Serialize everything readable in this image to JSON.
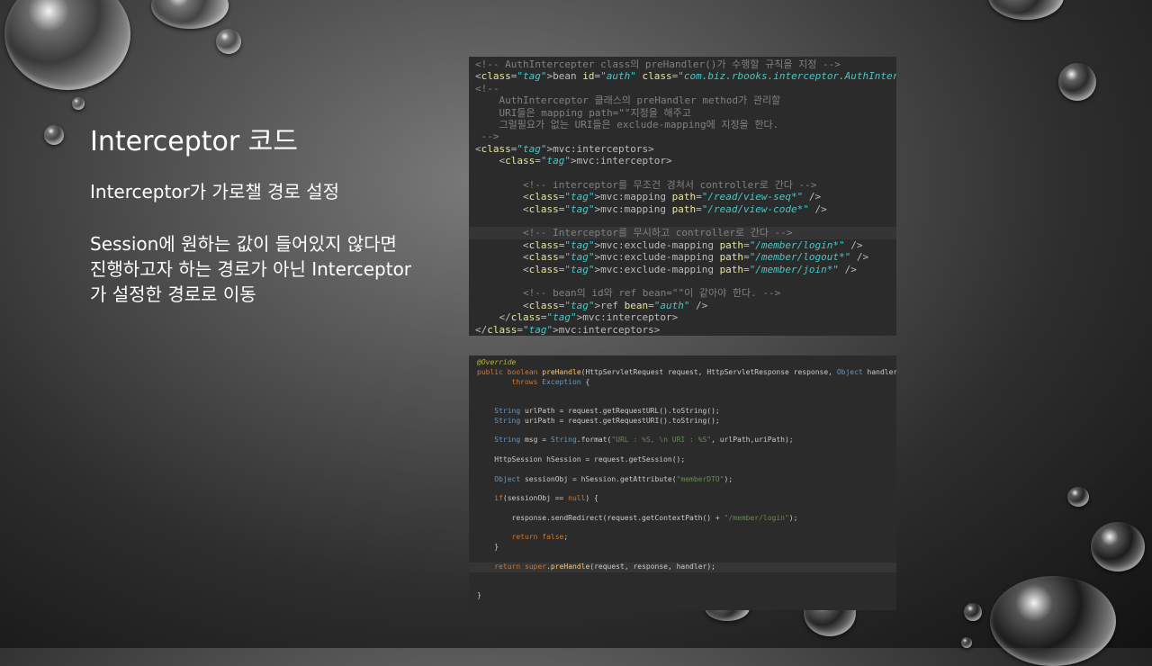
{
  "slide": {
    "title": "Interceptor 코드",
    "text1": "Interceptor가 가로챌 경로 설정",
    "text2": "Session에 원하는 값이 들어있지 않다면 진행하고자 하는 경로가 아닌 Interceptor가 설정한 경로로 이동"
  },
  "xml_code": [
    "<!-- AuthIntercepter class의 preHandler()가 수행할 규칙을 지정 -->",
    "<bean id=\"auth\" class=\"com.biz.rbooks.interceptor.AuthInterceptor\" />",
    "<!--",
    "    AuthInterceptor 클래스의 preHandler method가 관리할",
    "    URI들은 mapping path=\"\"지정을 해주고",
    "    그럴필요가 없는 URI들은 exclude-mapping에 지정을 한다.",
    " -->",
    "<mvc:interceptors>",
    "    <mvc:interceptor>",
    "",
    "        <!-- interceptor를 무조건 경쳐서 controller로 간다 -->",
    "        <mvc:mapping path=\"/read/view-seq*\" />",
    "        <mvc:mapping path=\"/read/view-code*\" />",
    "",
    "        <!-- Interceptor를 무시하고 controller로 간다 -->",
    "        <mvc:exclude-mapping path=\"/member/login*\" />",
    "        <mvc:exclude-mapping path=\"/member/logout*\" />",
    "        <mvc:exclude-mapping path=\"/member/join*\" />",
    "",
    "        <!-- bean의 id와 ref bean=\"\"이 같아야 한다. -->",
    "        <ref bean=\"auth\" />",
    "    </mvc:interceptor>",
    "</mvc:interceptors>"
  ],
  "java_code": [
    "@Override",
    "public boolean preHandle(HttpServletRequest request, HttpServletResponse response, Object handler)",
    "        throws Exception {",
    "",
    "",
    "    String urlPath = request.getRequestURL().toString();",
    "    String uriPath = request.getRequestURI().toString();",
    "",
    "    String msg = String.format(\"URL : %S, \\n URI : %S\", urlPath,uriPath);",
    "",
    "    HttpSession hSession = request.getSession();",
    "",
    "    Object sessionObj = hSession.getAttribute(\"memberDTO\");",
    "",
    "    if(sessionObj == null) {",
    "",
    "        response.sendRedirect(request.getContextPath() + \"/member/login\");",
    "",
    "        return false;",
    "    }",
    "",
    "    return super.preHandle(request, response, handler);",
    "",
    "",
    "}"
  ]
}
